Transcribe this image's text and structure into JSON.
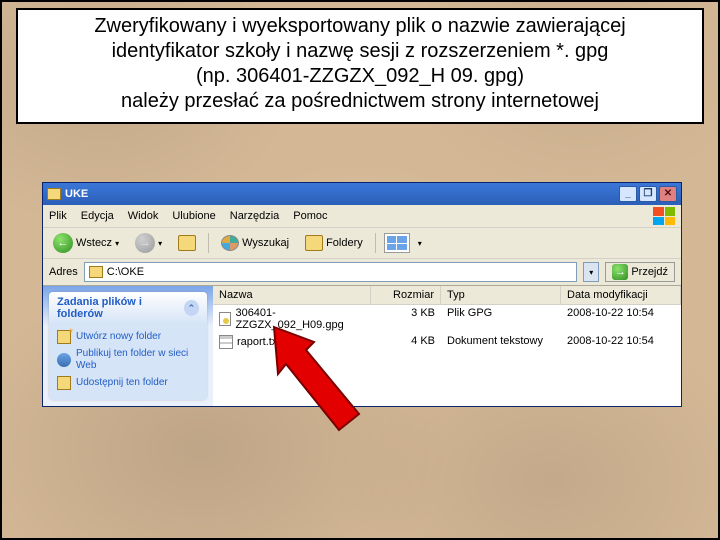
{
  "instruction": {
    "line1": "Zweryfikowany i wyeksportowany plik o nazwie zawierającej",
    "line2": "identyfikator szkoły i nazwę sesji z rozszerzeniem *. gpg",
    "line3": "(np. 306401-ZZGZX_092_H 09. gpg)",
    "line4": "należy przesłać za pośrednictwem strony internetowej"
  },
  "titlebar": {
    "title": "UKE"
  },
  "winbtns": {
    "min": "_",
    "max": "❐",
    "close": "✕"
  },
  "menu": {
    "file": "Plik",
    "edit": "Edycja",
    "view": "Widok",
    "fav": "Ulubione",
    "tools": "Narzędzia",
    "help": "Pomoc"
  },
  "toolbar": {
    "back": "Wstecz",
    "search": "Wyszukaj",
    "folders": "Foldery"
  },
  "addr": {
    "label": "Adres",
    "value": "C:\\OKE"
  },
  "go": {
    "label": "Przejdź"
  },
  "tasks": {
    "header": "Zadania plików i folderów",
    "new": "Utwórz nowy folder",
    "publish": "Publikuj ten folder w sieci Web",
    "share": "Udostępnij ten folder"
  },
  "columns": {
    "name": "Nazwa",
    "size": "Rozmiar",
    "type": "Typ",
    "date": "Data modyfikacji"
  },
  "files": [
    {
      "name": "306401-ZZGZX_092_H09.gpg",
      "size": "3 KB",
      "type": "Plik GPG",
      "date": "2008-10-22 10:54"
    },
    {
      "name": "raport.txt",
      "size": "4 KB",
      "type": "Dokument tekstowy",
      "date": "2008-10-22 10:54"
    }
  ]
}
